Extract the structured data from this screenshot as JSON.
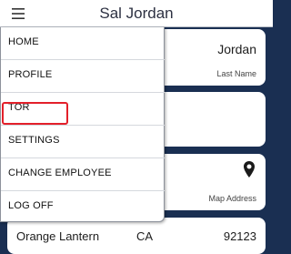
{
  "header": {
    "title": "Sal Jordan",
    "menu_icon": "hamburger-menu-icon"
  },
  "cards": {
    "name": {
      "value": "Jordan",
      "caption": "Last Name"
    },
    "address": {
      "icon": "location-pin-icon",
      "caption": "Map Address"
    },
    "bottom": {
      "left": "Orange Lantern",
      "middle": "CA",
      "right": "92123"
    }
  },
  "nav_menu": {
    "items": [
      {
        "label": "HOME"
      },
      {
        "label": "PROFILE"
      },
      {
        "label": "TOR"
      },
      {
        "label": "SETTINGS",
        "highlighted": true
      },
      {
        "label": "CHANGE EMPLOYEE"
      },
      {
        "label": "LOG OFF"
      }
    ]
  },
  "colors": {
    "background": "#1a2f52",
    "highlight": "#e3202a"
  }
}
